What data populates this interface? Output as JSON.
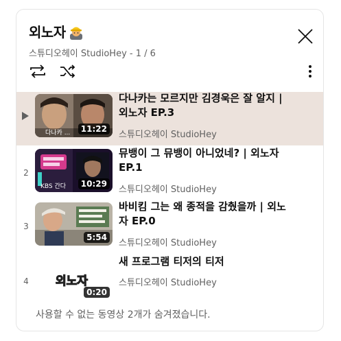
{
  "playlist": {
    "title": "외노자",
    "title_emoji": "construction-worker-emoji",
    "subtitle": "스튜디오헤이 StudioHey - 1 / 6",
    "controls": {
      "loop": "repeat-icon",
      "shuffle": "shuffle-icon",
      "close": "close-icon",
      "more": "more-vert-icon"
    },
    "colors": {
      "active_row_bg": "#ece2dc",
      "secondary_text": "#606060"
    }
  },
  "videos": [
    {
      "index": "▶",
      "title": "다나카는 모르지만 김경욱은 잘 알지 | 외노자 EP.3",
      "channel": "스튜디오헤이 StudioHey",
      "duration": "11:22",
      "thumb_caption": "다나카 ...",
      "active": true
    },
    {
      "index": "2",
      "title": "뮤뱅이 그 뮤뱅이 아니었네? | 외노자 EP.1",
      "channel": "스튜디오헤이 StudioHey",
      "duration": "10:29",
      "thumb_caption": "KBS 간다"
    },
    {
      "index": "3",
      "title": "바비킴 그는 왜 종적을 감췄을까 | 외노자 EP.0",
      "channel": "스튜디오헤이 StudioHey",
      "duration": "5:54",
      "thumb_caption": ""
    },
    {
      "index": "4",
      "title": "새 프로그램 티저의 티저",
      "channel": "스튜디오헤이 StudioHey",
      "duration": "0:20",
      "thumb_caption": "외노자"
    }
  ],
  "footer": "사용할 수 없는 동영상 2개가 숨겨졌습니다."
}
